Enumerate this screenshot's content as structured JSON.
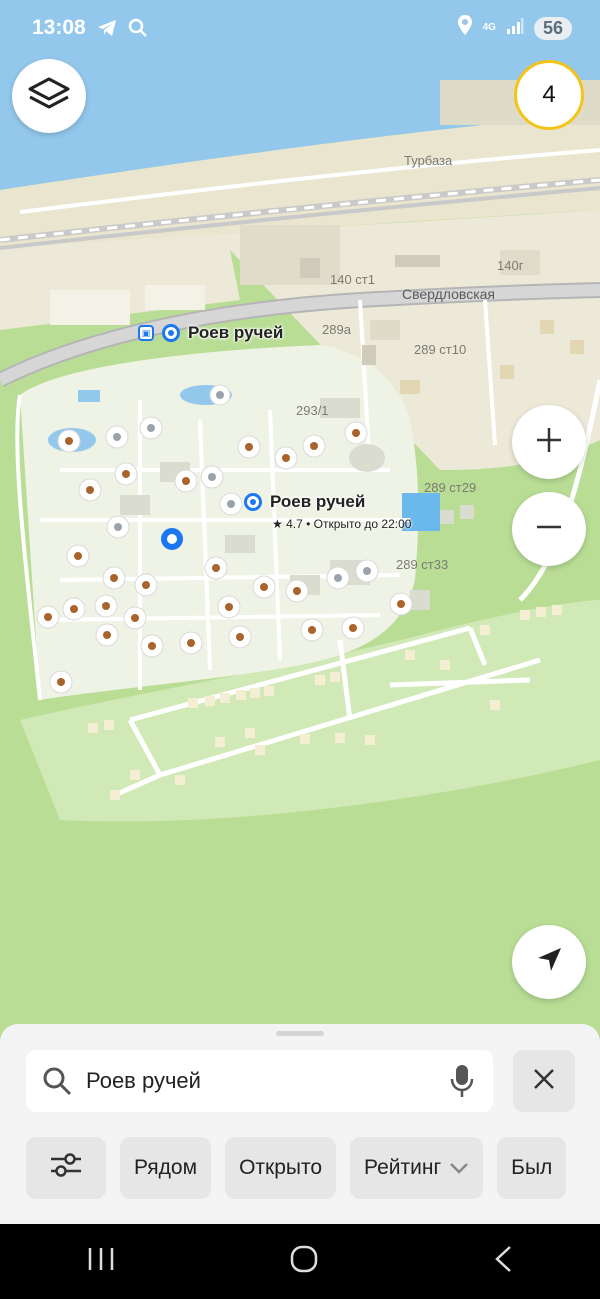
{
  "status_bar": {
    "time": "13:08",
    "network": "4G",
    "battery": "56",
    "icons": [
      "telegram-icon",
      "search-icon",
      "location-icon",
      "signal-icon"
    ]
  },
  "map": {
    "labels": {
      "turbaza": "Турбаза",
      "street": "Свердловская",
      "b140": "140 ст1",
      "b140g": "140г",
      "b289a": "289а",
      "b289st10": "289 ст10",
      "b2931": "293/1",
      "b289st29": "289 ст29",
      "b289st33": "289 ст33"
    },
    "pois": {
      "stop_name": "Роев ручей",
      "zoo_name": "Роев ручей",
      "zoo_info": "★ 4.7 • Открыто до 22:00"
    },
    "layer_count": "4",
    "colors": {
      "water": "#93c8ec",
      "land": "#ede9d8",
      "green": "#b9dd95",
      "zoo": "#eff3e6",
      "accent": "#1c78f2",
      "badge_ring": "#f5c419"
    }
  },
  "controls": {
    "layers": "layers-icon",
    "zoom_in": "plus-icon",
    "zoom_out": "minus-icon",
    "locate": "navigation-arrow-icon"
  },
  "sheet": {
    "search_value": "Роев ручей",
    "chips": {
      "filters_icon": "filters-icon",
      "nearby": "Рядом",
      "open": "Открыто",
      "rating": "Рейтинг",
      "cut": "Был"
    }
  },
  "nav": [
    "recent-apps-icon",
    "home-icon",
    "back-icon"
  ]
}
